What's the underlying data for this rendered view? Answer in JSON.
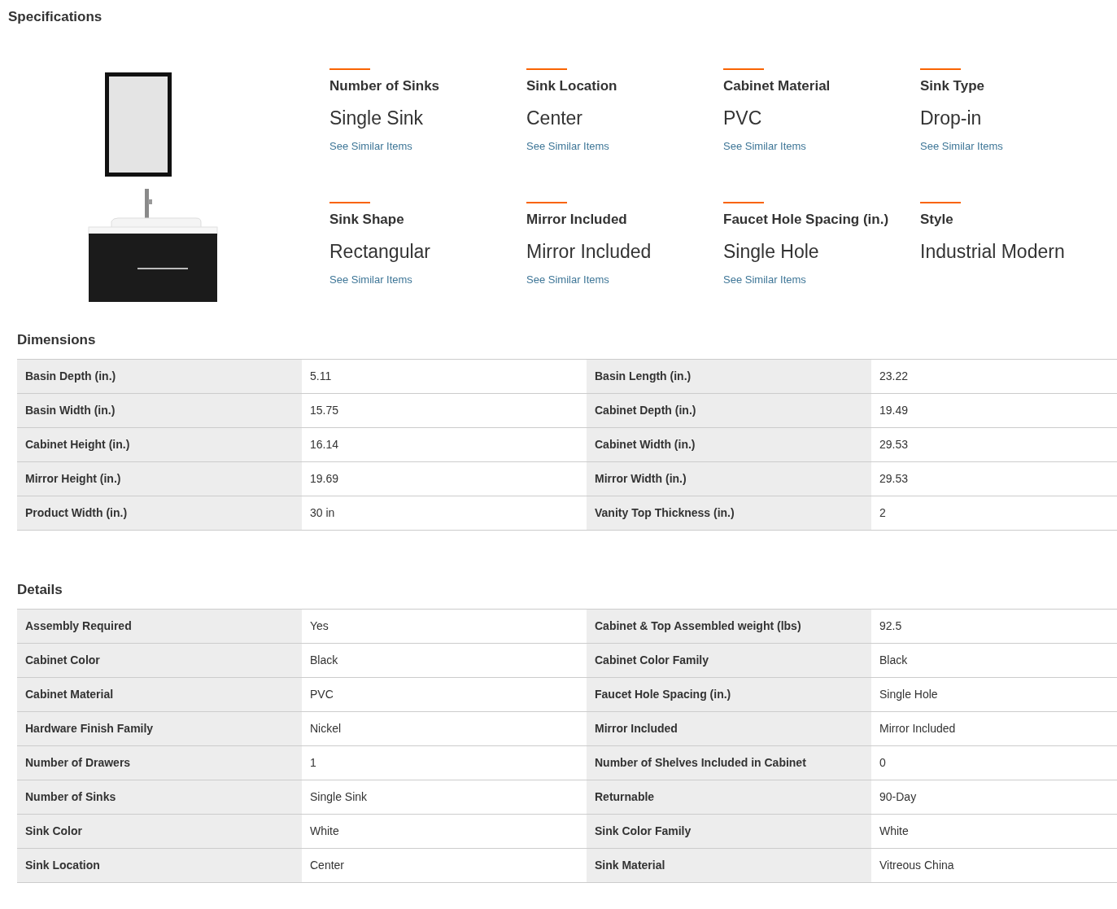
{
  "title": "Specifications",
  "highlights": [
    {
      "label": "Number of Sinks",
      "value": "Single Sink",
      "link": "See Similar Items"
    },
    {
      "label": "Sink Location",
      "value": "Center",
      "link": "See Similar Items"
    },
    {
      "label": "Cabinet Material",
      "value": "PVC",
      "link": "See Similar Items"
    },
    {
      "label": "Sink Type",
      "value": "Drop-in",
      "link": "See Similar Items"
    },
    {
      "label": "Sink Shape",
      "value": "Rectangular",
      "link": "See Similar Items"
    },
    {
      "label": "Mirror Included",
      "value": "Mirror Included",
      "link": "See Similar Items"
    },
    {
      "label": "Faucet Hole Spacing (in.)",
      "value": "Single Hole",
      "link": "See Similar Items"
    },
    {
      "label": "Style",
      "value": "Industrial Modern"
    }
  ],
  "sections": [
    {
      "heading": "Dimensions",
      "rows": [
        [
          "Basin Depth (in.)",
          "5.11",
          "Basin Length (in.)",
          "23.22"
        ],
        [
          "Basin Width (in.)",
          "15.75",
          "Cabinet Depth (in.)",
          "19.49"
        ],
        [
          "Cabinet Height (in.)",
          "16.14",
          "Cabinet Width (in.)",
          "29.53"
        ],
        [
          "Mirror Height (in.)",
          "19.69",
          "Mirror Width (in.)",
          "29.53"
        ],
        [
          "Product Width (in.)",
          "30 in",
          "Vanity Top Thickness (in.)",
          "2"
        ]
      ]
    },
    {
      "heading": "Details",
      "rows": [
        [
          "Assembly Required",
          "Yes",
          "Cabinet & Top Assembled weight (lbs)",
          "92.5"
        ],
        [
          "Cabinet Color",
          "Black",
          "Cabinet Color Family",
          "Black"
        ],
        [
          "Cabinet Material",
          "PVC",
          "Faucet Hole Spacing (in.)",
          "Single Hole"
        ],
        [
          "Hardware Finish Family",
          "Nickel",
          "Mirror Included",
          "Mirror Included"
        ],
        [
          "Number of Drawers",
          "1",
          "Number of Shelves Included in Cabinet",
          "0"
        ],
        [
          "Number of Sinks",
          "Single Sink",
          "Returnable",
          "90-Day"
        ],
        [
          "Sink Color",
          "White",
          "Sink Color Family",
          "White"
        ],
        [
          "Sink Location",
          "Center",
          "Sink Material",
          "Vitreous China"
        ]
      ]
    }
  ]
}
